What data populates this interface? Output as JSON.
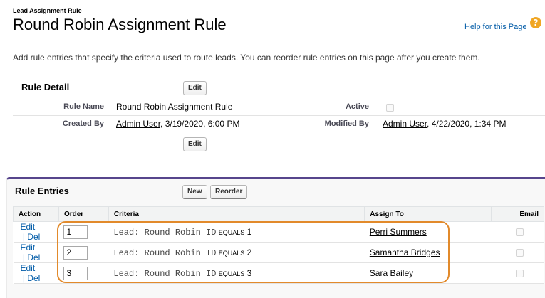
{
  "header": {
    "entity_label": "Lead Assignment Rule",
    "title": "Round Robin Assignment Rule",
    "help_link": "Help for this Page",
    "help_icon": "question-mark",
    "help_icon_glyph": "?"
  },
  "description": "Add rule entries that specify the criteria used to route leads. You can reorder rule entries on this page after you create them.",
  "rule_detail": {
    "section_title": "Rule Detail",
    "edit_label": "Edit",
    "fields": {
      "rule_name_label": "Rule Name",
      "rule_name_value": "Round Robin Assignment Rule",
      "active_label": "Active",
      "active_checked": false,
      "created_by_label": "Created By",
      "created_by_user": "Admin User",
      "created_by_date": ", 3/19/2020, 6:00 PM",
      "modified_by_label": "Modified By",
      "modified_by_user": "Admin User",
      "modified_by_date": ", 4/22/2020, 1:34 PM"
    }
  },
  "rule_entries": {
    "section_title": "Rule Entries",
    "new_label": "New",
    "reorder_label": "Reorder",
    "columns": [
      "Action",
      "Order",
      "Criteria",
      "Assign To",
      "Email"
    ],
    "edit_link": "Edit",
    "separator": " | ",
    "del_link": "Del",
    "rows": [
      {
        "order": "1",
        "criteria_field": "Lead: Round Robin ID",
        "operator": "EQUALS",
        "value": "1",
        "assign_to": "Perri Summers",
        "email": false
      },
      {
        "order": "2",
        "criteria_field": "Lead: Round Robin ID",
        "operator": "EQUALS",
        "value": "2",
        "assign_to": "Samantha Bridges",
        "email": false
      },
      {
        "order": "3",
        "criteria_field": "Lead: Round Robin ID",
        "operator": "EQUALS",
        "value": "3",
        "assign_to": "Sara Bailey",
        "email": false
      }
    ]
  },
  "colors": {
    "accent_border": "#56458c",
    "highlight": "#e28a2b",
    "link": "#015ba7",
    "help_icon": "#f0a623"
  }
}
